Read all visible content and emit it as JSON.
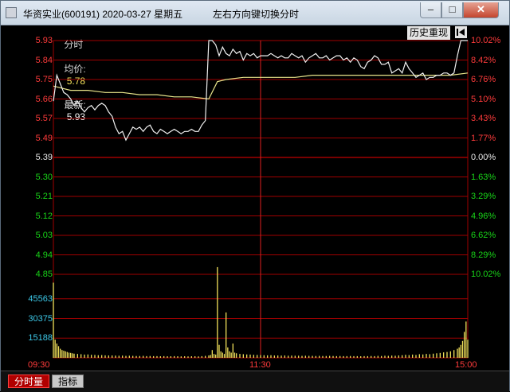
{
  "window": {
    "title": "华资实业(600191) 2020-03-27 星期五",
    "hint": "左右方向键切换分时",
    "minimize_label": "–",
    "maximize_label": "□",
    "close_label": "✕",
    "icons": {
      "app": "app-icon",
      "back": "back-arrow-icon"
    }
  },
  "legend": {
    "mode_label": "分时",
    "avg_label": "均价:",
    "avg_value": "5.78",
    "last_label": "最新:",
    "last_value": "5.93",
    "history_button": "历史重现"
  },
  "colors": {
    "up": "#ff3b3b",
    "down": "#18d418",
    "price_line": "#f0f0f0",
    "avg_line": "#e8e48a",
    "grid": "#a00000",
    "volume": "#f0e05a"
  },
  "chart_data": {
    "type": "line",
    "prev_close": 5.39,
    "y_ticks": [
      "5.93",
      "5.84",
      "5.75",
      "5.66",
      "5.57",
      "5.49",
      "5.39",
      "5.30",
      "5.21",
      "5.12",
      "5.03",
      "4.94",
      "4.85"
    ],
    "pct_ticks": [
      "10.02%",
      "8.42%",
      "6.76%",
      "5.10%",
      "3.43%",
      "1.77%",
      "0.00%",
      "1.63%",
      "3.29%",
      "4.96%",
      "6.62%",
      "8.29%",
      "10.02%"
    ],
    "ylim": [
      4.85,
      5.93
    ],
    "x_ticks": [
      "09:30",
      "11:30",
      "15:00"
    ],
    "volume_ticks": [
      "45563",
      "30375",
      "15188"
    ],
    "volume_max": 60750,
    "series": [
      {
        "role": "price",
        "x": [
          0,
          2,
          4,
          6,
          8,
          10,
          12,
          14,
          16,
          18,
          20,
          22,
          24,
          26,
          28,
          30,
          32,
          34,
          36,
          38,
          40,
          42,
          44,
          46,
          48,
          50,
          52,
          54,
          56,
          58,
          60,
          62,
          64,
          66,
          68,
          70,
          72,
          74,
          76,
          78,
          80,
          82,
          84,
          86,
          88,
          90,
          92,
          94,
          96,
          98,
          100,
          102,
          104,
          106,
          108,
          110,
          112,
          114,
          116,
          118,
          120,
          122,
          124,
          126,
          128,
          130,
          132,
          134,
          136,
          138,
          140,
          142,
          144,
          146,
          148,
          150,
          152,
          154,
          156,
          158,
          160,
          162,
          164,
          166,
          168,
          170,
          172,
          174,
          176,
          178,
          180,
          182,
          184,
          186,
          188,
          190,
          192,
          194,
          196,
          198,
          200,
          202,
          204,
          206,
          208,
          210,
          212,
          214,
          216,
          218,
          220,
          222,
          224,
          226,
          228,
          230,
          232,
          234,
          236,
          238,
          240
        ],
        "y": [
          5.65,
          5.77,
          5.73,
          5.69,
          5.68,
          5.66,
          5.63,
          5.65,
          5.62,
          5.6,
          5.62,
          5.63,
          5.61,
          5.63,
          5.64,
          5.63,
          5.6,
          5.58,
          5.53,
          5.5,
          5.51,
          5.47,
          5.5,
          5.53,
          5.52,
          5.53,
          5.51,
          5.53,
          5.54,
          5.51,
          5.5,
          5.52,
          5.51,
          5.5,
          5.51,
          5.52,
          5.51,
          5.5,
          5.51,
          5.51,
          5.52,
          5.51,
          5.51,
          5.54,
          5.56,
          5.93,
          5.93,
          5.91,
          5.86,
          5.9,
          5.87,
          5.86,
          5.89,
          5.87,
          5.88,
          5.84,
          5.87,
          5.86,
          5.87,
          5.85,
          5.86,
          5.86,
          5.86,
          5.87,
          5.86,
          5.85,
          5.86,
          5.85,
          5.85,
          5.87,
          5.86,
          5.85,
          5.86,
          5.83,
          5.85,
          5.86,
          5.87,
          5.85,
          5.85,
          5.86,
          5.84,
          5.85,
          5.86,
          5.86,
          5.84,
          5.85,
          5.83,
          5.85,
          5.84,
          5.81,
          5.8,
          5.83,
          5.84,
          5.86,
          5.85,
          5.82,
          5.82,
          5.83,
          5.78,
          5.79,
          5.8,
          5.78,
          5.83,
          5.8,
          5.78,
          5.76,
          5.77,
          5.78,
          5.75,
          5.76,
          5.76,
          5.77,
          5.77,
          5.78,
          5.78,
          5.77,
          5.78,
          5.86,
          5.93,
          5.93,
          5.93
        ]
      },
      {
        "role": "average",
        "x": [
          0,
          5,
          10,
          20,
          30,
          40,
          50,
          60,
          70,
          80,
          90,
          95,
          100,
          110,
          120,
          130,
          140,
          150,
          160,
          170,
          180,
          190,
          200,
          210,
          220,
          230,
          240
        ],
        "y": [
          5.72,
          5.71,
          5.7,
          5.7,
          5.69,
          5.69,
          5.68,
          5.68,
          5.67,
          5.67,
          5.66,
          5.74,
          5.75,
          5.76,
          5.76,
          5.76,
          5.76,
          5.77,
          5.77,
          5.77,
          5.77,
          5.77,
          5.77,
          5.77,
          5.77,
          5.77,
          5.78
        ]
      },
      {
        "role": "volume",
        "x": [
          0,
          1,
          2,
          3,
          4,
          5,
          6,
          7,
          8,
          9,
          10,
          11,
          12,
          14,
          16,
          18,
          20,
          22,
          24,
          26,
          28,
          30,
          32,
          34,
          36,
          38,
          40,
          42,
          44,
          46,
          48,
          50,
          52,
          54,
          56,
          58,
          60,
          62,
          64,
          66,
          68,
          70,
          72,
          74,
          76,
          78,
          80,
          82,
          84,
          86,
          88,
          90,
          91,
          92,
          93,
          94,
          95,
          96,
          97,
          98,
          99,
          100,
          101,
          102,
          103,
          104,
          105,
          106,
          108,
          110,
          112,
          114,
          116,
          118,
          120,
          122,
          124,
          126,
          128,
          130,
          132,
          134,
          136,
          138,
          140,
          142,
          144,
          146,
          148,
          150,
          152,
          154,
          156,
          158,
          160,
          162,
          164,
          166,
          168,
          170,
          172,
          174,
          176,
          178,
          180,
          182,
          184,
          186,
          188,
          190,
          192,
          194,
          196,
          198,
          200,
          202,
          204,
          206,
          208,
          210,
          212,
          214,
          216,
          218,
          220,
          222,
          224,
          226,
          228,
          230,
          232,
          234,
          235,
          236,
          237,
          238,
          239,
          240
        ],
        "v": [
          58000,
          14000,
          11000,
          9000,
          7000,
          6000,
          5500,
          5000,
          4500,
          4000,
          3800,
          3500,
          3200,
          3000,
          2800,
          2500,
          2600,
          2300,
          2200,
          2000,
          2100,
          1900,
          1800,
          1800,
          1700,
          1600,
          1700,
          1500,
          1600,
          1500,
          1400,
          1400,
          1500,
          1300,
          1400,
          1300,
          1300,
          1200,
          1300,
          1200,
          1200,
          1300,
          1200,
          1100,
          1200,
          1100,
          1200,
          1200,
          1100,
          1300,
          1500,
          1800,
          2200,
          6000,
          3000,
          2500,
          70000,
          10000,
          5000,
          4000,
          3000,
          35000,
          8000,
          5000,
          4000,
          11000,
          4000,
          3500,
          3000,
          2800,
          2600,
          2500,
          2300,
          2200,
          2100,
          2000,
          1900,
          2000,
          1800,
          1800,
          1700,
          1800,
          1600,
          1700,
          1600,
          1600,
          1500,
          1600,
          1500,
          1500,
          1400,
          1500,
          1400,
          1400,
          1500,
          1400,
          1300,
          1400,
          1300,
          1300,
          1400,
          1300,
          1300,
          1200,
          1300,
          1300,
          1400,
          1300,
          1500,
          1400,
          1600,
          1500,
          1700,
          1600,
          1800,
          2000,
          2300,
          2100,
          2500,
          2200,
          2800,
          2600,
          3000,
          2800,
          3200,
          3500,
          3800,
          4200,
          4500,
          5000,
          6000,
          7000,
          8000,
          10000,
          13000,
          20000,
          28000,
          14000
        ]
      }
    ]
  },
  "bottom_tabs": {
    "active": "分时量",
    "inactive": "指标"
  }
}
